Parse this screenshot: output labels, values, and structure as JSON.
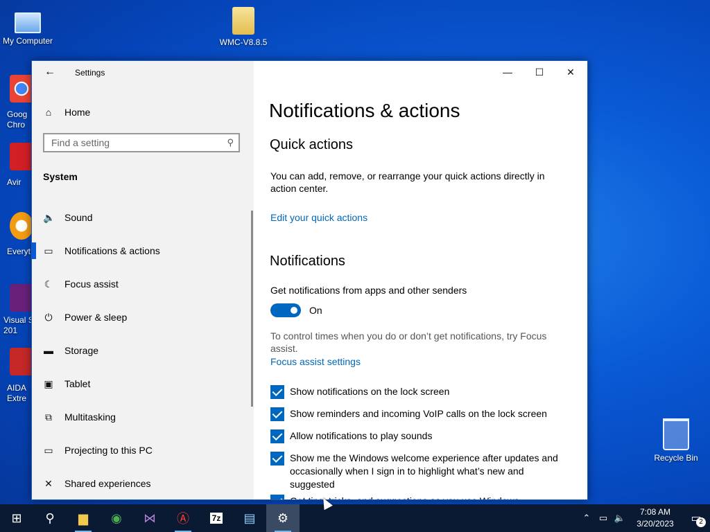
{
  "desktop": {
    "icons": [
      {
        "label": "My Computer"
      },
      {
        "label": "WMC-V8.8.5"
      },
      {
        "label": "Recycle Bin"
      }
    ],
    "side_icons": [
      {
        "label": "Goog\nChro",
        "color": "#e53935"
      },
      {
        "label": "Avir",
        "color": "#d21f26"
      },
      {
        "label": "Everyt",
        "color": "#f39c12"
      },
      {
        "label": "Visual S\n201",
        "color": "#68217a"
      },
      {
        "label": "AIDA\nExtre",
        "color": "#c62828"
      }
    ]
  },
  "window": {
    "title": "Settings",
    "controls": {
      "minimize": "—",
      "maximize": "☐",
      "close": "✕"
    },
    "sidebar": {
      "home_label": "Home",
      "search_placeholder": "Find a setting",
      "section_label": "System",
      "items": [
        {
          "label": "Sound",
          "icon": "speaker-icon",
          "glyph": "🔈"
        },
        {
          "label": "Notifications & actions",
          "icon": "message-icon",
          "glyph": "▭",
          "active": true
        },
        {
          "label": "Focus assist",
          "icon": "moon-icon",
          "glyph": "☾"
        },
        {
          "label": "Power & sleep",
          "icon": "power-icon",
          "glyph": "⏻"
        },
        {
          "label": "Storage",
          "icon": "storage-icon",
          "glyph": "▬"
        },
        {
          "label": "Tablet",
          "icon": "tablet-icon",
          "glyph": "▣"
        },
        {
          "label": "Multitasking",
          "icon": "multitasking-icon",
          "glyph": "⧉"
        },
        {
          "label": "Projecting to this PC",
          "icon": "projecting-icon",
          "glyph": "▭"
        },
        {
          "label": "Shared experiences",
          "icon": "shared-icon",
          "glyph": "✕"
        }
      ]
    },
    "content": {
      "page_title": "Notifications & actions",
      "quick_actions": {
        "heading": "Quick actions",
        "description": "You can add, remove, or rearrange your quick actions directly in action center.",
        "link": "Edit your quick actions"
      },
      "notifications": {
        "heading": "Notifications",
        "toggle_label": "Get notifications from apps and other senders",
        "toggle_state": "On",
        "focus_text": "To control times when you do or don’t get notifications, try Focus assist.",
        "focus_link": "Focus assist settings",
        "checkboxes": [
          {
            "label": "Show notifications on the lock screen",
            "checked": true
          },
          {
            "label": "Show reminders and incoming VoIP calls on the lock screen",
            "checked": true
          },
          {
            "label": "Allow notifications to play sounds",
            "checked": true
          },
          {
            "label": "Show me the Windows welcome experience after updates and occasionally when I sign in to highlight what’s new and suggested",
            "checked": true
          },
          {
            "label": "Get tips, tricks, and suggestions as you use Windows",
            "checked": true
          }
        ]
      }
    }
  },
  "taskbar": {
    "time": "7:08 AM",
    "date": "3/20/2023",
    "notification_count": "2",
    "apps": [
      {
        "name": "start-button",
        "glyph": "⊞"
      },
      {
        "name": "search-button",
        "glyph": "⚲"
      },
      {
        "name": "file-explorer",
        "glyph": "▆"
      },
      {
        "name": "chrome",
        "glyph": "◉"
      },
      {
        "name": "visual-studio",
        "glyph": "⋈"
      },
      {
        "name": "avira",
        "glyph": "Ⓐ"
      },
      {
        "name": "7zip",
        "glyph": "7z"
      },
      {
        "name": "control-panel",
        "glyph": "▤"
      },
      {
        "name": "settings",
        "glyph": "⚙"
      }
    ]
  }
}
